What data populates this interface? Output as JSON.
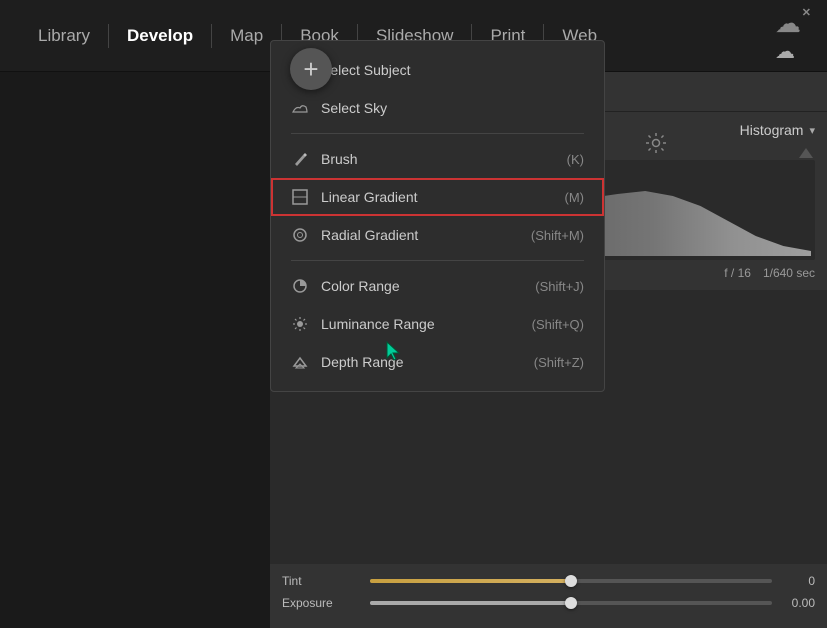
{
  "nav": {
    "items": [
      {
        "id": "library",
        "label": "Library",
        "active": false
      },
      {
        "id": "develop",
        "label": "Develop",
        "active": true
      },
      {
        "id": "map",
        "label": "Map",
        "active": false
      },
      {
        "id": "book",
        "label": "Book",
        "active": false
      },
      {
        "id": "slideshow",
        "label": "Slideshow",
        "active": false
      },
      {
        "id": "print",
        "label": "Print",
        "active": false
      },
      {
        "id": "web",
        "label": "Web",
        "active": false
      }
    ]
  },
  "histogram": {
    "label": "Histogram",
    "info_left": "f / 16",
    "info_right": "1/640 sec"
  },
  "plus_button": {
    "label": "+"
  },
  "mask_menu": {
    "items": [
      {
        "id": "select-subject",
        "icon": "👤",
        "label": "Select Subject",
        "shortcut": "",
        "highlighted": false
      },
      {
        "id": "select-sky",
        "icon": "🏔",
        "label": "Select Sky",
        "shortcut": "",
        "highlighted": false
      },
      {
        "id": "brush",
        "icon": "✏",
        "label": "Brush",
        "shortcut": "(K)",
        "highlighted": false
      },
      {
        "id": "linear-gradient",
        "icon": "□",
        "label": "Linear Gradient",
        "shortcut": "(M)",
        "highlighted": true
      },
      {
        "id": "radial-gradient",
        "icon": "◎",
        "label": "Radial Gradient",
        "shortcut": "(Shift+M)",
        "highlighted": false
      },
      {
        "id": "color-range",
        "icon": "◑",
        "label": "Color Range",
        "shortcut": "(Shift+J)",
        "highlighted": false
      },
      {
        "id": "luminance-range",
        "icon": "✦",
        "label": "Luminance Range",
        "shortcut": "(Shift+Q)",
        "highlighted": false
      },
      {
        "id": "depth-range",
        "icon": "⛰",
        "label": "Depth Range",
        "shortcut": "(Shift+Z)",
        "highlighted": false
      }
    ]
  },
  "sliders": {
    "tint": {
      "label": "Tint",
      "value": "0",
      "fill_pct": 50
    },
    "exposure": {
      "label": "Exposure",
      "value": "0.00",
      "fill_pct": 50
    }
  },
  "toolbar": {
    "panel_icon1": "▣",
    "panel_icon2": "—",
    "collapse": "«"
  },
  "histogram_header": {
    "label": "Histogram",
    "arrow": "▾"
  }
}
